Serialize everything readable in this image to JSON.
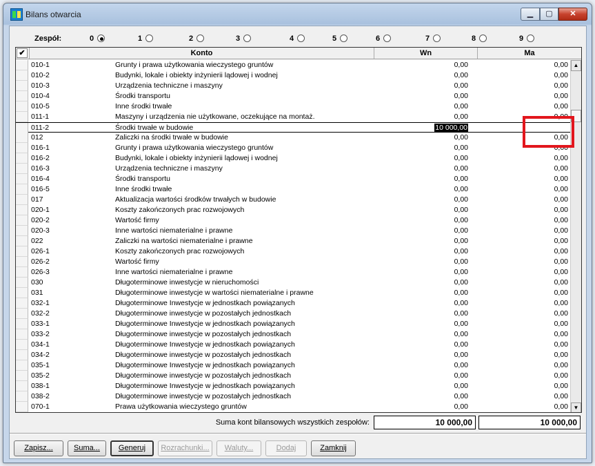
{
  "window": {
    "title": "Bilans otwarcia"
  },
  "team": {
    "label": "Zespół:",
    "options": [
      {
        "label": "0",
        "selected": true
      },
      {
        "label": "1",
        "selected": false
      },
      {
        "label": "2",
        "selected": false
      },
      {
        "label": "3",
        "selected": false
      },
      {
        "label": "4",
        "selected": false
      },
      {
        "label": "5",
        "selected": false
      },
      {
        "label": "6",
        "selected": false
      },
      {
        "label": "7",
        "selected": false
      },
      {
        "label": "8",
        "selected": false
      },
      {
        "label": "9",
        "selected": false
      }
    ]
  },
  "grid": {
    "headers": {
      "check": "✔",
      "konto": "Konto",
      "wn": "Wn",
      "ma": "Ma"
    },
    "rows": [
      {
        "konto": "010-1",
        "name": "Grunty i prawa użytkowania wieczystego gruntów",
        "wn": "0,00",
        "ma": "0,00"
      },
      {
        "konto": "010-2",
        "name": "Budynki, lokale i obiekty inżynierii lądowej i wodnej",
        "wn": "0,00",
        "ma": "0,00"
      },
      {
        "konto": "010-3",
        "name": "Urządzenia techniczne i maszyny",
        "wn": "0,00",
        "ma": "0,00"
      },
      {
        "konto": "010-4",
        "name": "Środki transportu",
        "wn": "0,00",
        "ma": "0,00"
      },
      {
        "konto": "010-5",
        "name": "Inne środki trwałe",
        "wn": "0,00",
        "ma": "0,00"
      },
      {
        "konto": "011-1",
        "name": "Maszyny i urządzenia nie użytkowane, oczekujące na montaż.",
        "wn": "0,00",
        "ma": "0,00"
      },
      {
        "konto": "011-2",
        "name": "Środki trwałe w budowie",
        "wn": "10 000,00",
        "ma": ""
      },
      {
        "konto": "012",
        "name": "Zaliczki na środki trwałe w budowie",
        "wn": "0,00",
        "ma": "0,00"
      },
      {
        "konto": "016-1",
        "name": "Grunty i prawa użytkowania wieczystego gruntów",
        "wn": "0,00",
        "ma": "0,00"
      },
      {
        "konto": "016-2",
        "name": "Budynki, lokale i obiekty inżynierii lądowej i wodnej",
        "wn": "0,00",
        "ma": "0,00"
      },
      {
        "konto": "016-3",
        "name": "Urządzenia techniczne i maszyny",
        "wn": "0,00",
        "ma": "0,00"
      },
      {
        "konto": "016-4",
        "name": "Środki transportu",
        "wn": "0,00",
        "ma": "0,00"
      },
      {
        "konto": "016-5",
        "name": "Inne środki trwałe",
        "wn": "0,00",
        "ma": "0,00"
      },
      {
        "konto": "017",
        "name": "Aktualizacja wartości środków trwałych w budowie",
        "wn": "0,00",
        "ma": "0,00"
      },
      {
        "konto": "020-1",
        "name": "Koszty zakończonych prac rozwojowych",
        "wn": "0,00",
        "ma": "0,00"
      },
      {
        "konto": "020-2",
        "name": "Wartość firmy",
        "wn": "0,00",
        "ma": "0,00"
      },
      {
        "konto": "020-3",
        "name": "Inne wartości niematerialne i prawne",
        "wn": "0,00",
        "ma": "0,00"
      },
      {
        "konto": "022",
        "name": "Zaliczki na wartości niematerialne i prawne",
        "wn": "0,00",
        "ma": "0,00"
      },
      {
        "konto": "026-1",
        "name": "Koszty zakończonych prac rozwojowych",
        "wn": "0,00",
        "ma": "0,00"
      },
      {
        "konto": "026-2",
        "name": "Wartość firmy",
        "wn": "0,00",
        "ma": "0,00"
      },
      {
        "konto": "026-3",
        "name": "Inne wartości niematerialne i prawne",
        "wn": "0,00",
        "ma": "0,00"
      },
      {
        "konto": "030",
        "name": "Długoterminowe inwestycje w nieruchomości",
        "wn": "0,00",
        "ma": "0,00"
      },
      {
        "konto": "031",
        "name": "Długoterminowe inwestycje w wartości niematerialne i prawne",
        "wn": "0,00",
        "ma": "0,00"
      },
      {
        "konto": "032-1",
        "name": "Długoterminowe Inwestycje w jednostkach powiązanych",
        "wn": "0,00",
        "ma": "0,00"
      },
      {
        "konto": "032-2",
        "name": "Długoterminowe inwestycje w pozostałych jednostkach",
        "wn": "0,00",
        "ma": "0,00"
      },
      {
        "konto": "033-1",
        "name": "Długoterminowe Inwestycje w jednostkach powiązanych",
        "wn": "0,00",
        "ma": "0,00"
      },
      {
        "konto": "033-2",
        "name": "Długoterminowe inwestycje w pozostałych jednostkach",
        "wn": "0,00",
        "ma": "0,00"
      },
      {
        "konto": "034-1",
        "name": "Długoterminowe Inwestycje w jednostkach powiązanych",
        "wn": "0,00",
        "ma": "0,00"
      },
      {
        "konto": "034-2",
        "name": "Długoterminowe inwestycje w pozostałych jednostkach",
        "wn": "0,00",
        "ma": "0,00"
      },
      {
        "konto": "035-1",
        "name": "Długoterminowe Inwestycje w jednostkach powiązanych",
        "wn": "0,00",
        "ma": "0,00"
      },
      {
        "konto": "035-2",
        "name": "Długoterminowe inwestycje w pozostałych jednostkach",
        "wn": "0,00",
        "ma": "0,00"
      },
      {
        "konto": "038-1",
        "name": "Długoterminowe Inwestycje w jednostkach powiązanych",
        "wn": "0,00",
        "ma": "0,00"
      },
      {
        "konto": "038-2",
        "name": "Długoterminowe inwestycje w pozostałych jednostkach",
        "wn": "0,00",
        "ma": "0,00"
      },
      {
        "konto": "070-1",
        "name": "Prawa użytkowania wieczystego gruntów",
        "wn": "0,00",
        "ma": "0,00"
      }
    ],
    "current_row": 6
  },
  "totals": {
    "label": "Suma kont bilansowych wszystkich zespołów:",
    "wn": "10 000,00",
    "ma": "10 000,00"
  },
  "buttons": [
    {
      "id": "zapisz",
      "label": "Zapisz...",
      "disabled": false
    },
    {
      "id": "suma",
      "label": "Suma...",
      "disabled": false
    },
    {
      "id": "generuj",
      "label": "Generuj",
      "disabled": false,
      "default": true
    },
    {
      "id": "rozrachunki",
      "label": "Rozrachunki...",
      "disabled": true
    },
    {
      "id": "waluty",
      "label": "Waluty...",
      "disabled": true
    },
    {
      "id": "dodaj",
      "label": "Dodaj",
      "disabled": true
    },
    {
      "id": "zamknij",
      "label": "Zamknij",
      "disabled": false
    }
  ],
  "colors": {
    "highlight_box": "#e2161d"
  }
}
